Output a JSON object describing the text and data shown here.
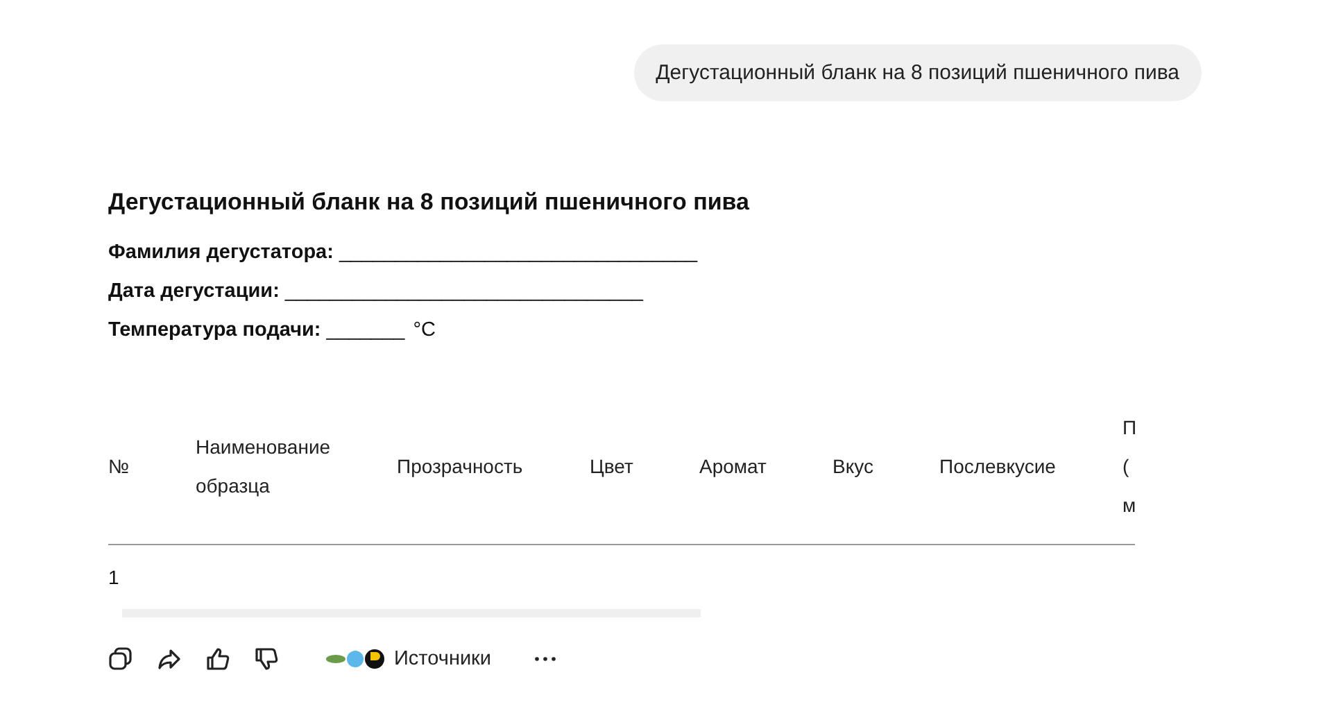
{
  "user_message": {
    "text": "Дегустационный бланк на 8 позиций пшеничного пива"
  },
  "answer": {
    "title": "Дегустационный бланк на 8 позиций пшеничного пива",
    "fields": [
      {
        "label": "Фамилия дегустатора:",
        "blank": "________________________________"
      },
      {
        "label": "Дата дегустации:",
        "blank": "________________________________"
      },
      {
        "label": "Температура подачи:",
        "blank": "_______",
        "unit": "°C"
      }
    ],
    "table": {
      "columns": [
        "№",
        "Наименование образца",
        "Прозрачность",
        "Цвет",
        "Аромат",
        "Вкус",
        "Послевкусие",
        "П ( м"
      ],
      "rows": [
        [
          "1",
          "",
          "",
          "",
          "",
          "",
          "",
          ""
        ]
      ]
    }
  },
  "actions": {
    "sources_label": "Источники"
  }
}
